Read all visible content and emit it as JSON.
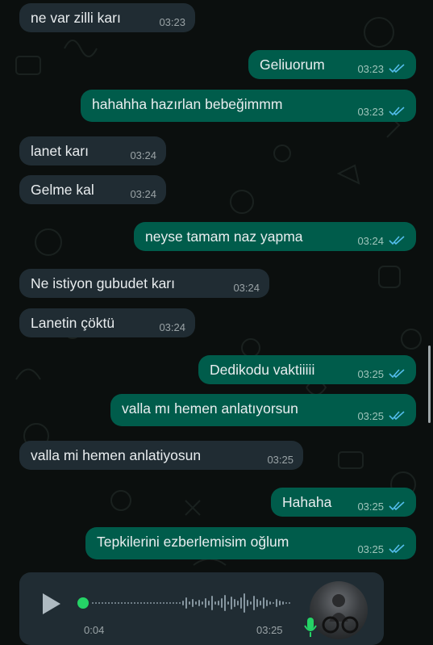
{
  "messages": [
    {
      "dir": "in",
      "text": "ne var zilli karı",
      "time": "03:23"
    },
    {
      "dir": "out",
      "text": "Geliuorum",
      "time": "03:23",
      "read": true
    },
    {
      "dir": "out",
      "text": "hahahha hazırlan bebeğimmm",
      "time": "03:23",
      "read": true
    },
    {
      "dir": "in",
      "text": "lanet karı",
      "time": "03:24"
    },
    {
      "dir": "in",
      "text": "Gelme kal",
      "time": "03:24"
    },
    {
      "dir": "out",
      "text": "neyse tamam naz yapma",
      "time": "03:24",
      "read": true
    },
    {
      "dir": "in",
      "text": "Ne istiyon gubudet karı",
      "time": "03:24"
    },
    {
      "dir": "in",
      "text": "Lanetin çöktü",
      "time": "03:24"
    },
    {
      "dir": "out",
      "text": "Dedikodu vaktiiiii",
      "time": "03:25",
      "read": true
    },
    {
      "dir": "out",
      "text": "valla mı hemen anlatıyorsun",
      "time": "03:25",
      "read": true
    },
    {
      "dir": "in",
      "text": "valla mi hemen anlatiyosun",
      "time": "03:25"
    },
    {
      "dir": "out",
      "text": "Hahaha",
      "time": "03:25",
      "read": true
    },
    {
      "dir": "out",
      "text": "Tepkilerini ezberlemisim oğlum",
      "time": "03:25",
      "read": true
    }
  ],
  "voice_message": {
    "duration": "0:04",
    "time": "03:25",
    "progress": 0,
    "icons": [
      "play-icon",
      "mic-icon"
    ]
  },
  "colors": {
    "incoming": "#202c33",
    "outgoing": "#005c4b",
    "read_ticks": "#53bdeb",
    "voice_dot": "#25d366"
  }
}
